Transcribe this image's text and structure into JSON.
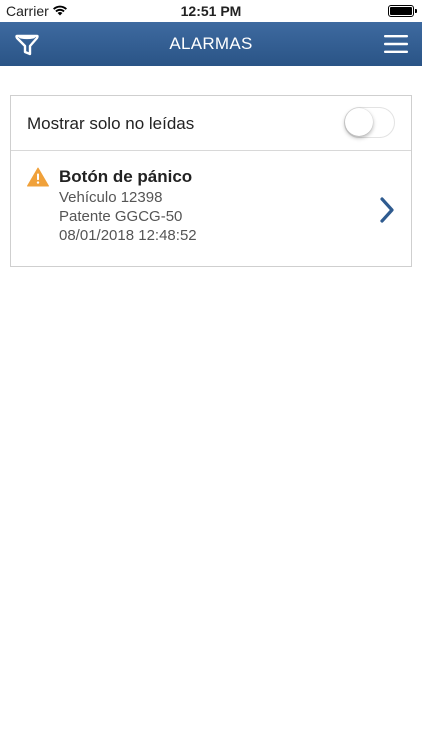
{
  "status_bar": {
    "carrier": "Carrier",
    "time": "12:51 PM",
    "icons": [
      "wifi-icon",
      "battery-icon"
    ]
  },
  "nav": {
    "title": "ALARMAS",
    "left_icon": "filter-icon",
    "right_icon": "hamburger-menu-icon",
    "bar_color": "#2f5b8f"
  },
  "filter": {
    "label": "Mostrar solo no leídas",
    "toggle_on": false
  },
  "alarms": [
    {
      "icon": "warning-icon",
      "icon_color": "#f0a13a",
      "name": "Botón de pánico",
      "vehicle": "Vehículo 12398",
      "plate": "Patente GGCG-50",
      "datetime": "08/01/2018 12:48:52",
      "chevron_color": "#2f5b8f"
    }
  ]
}
